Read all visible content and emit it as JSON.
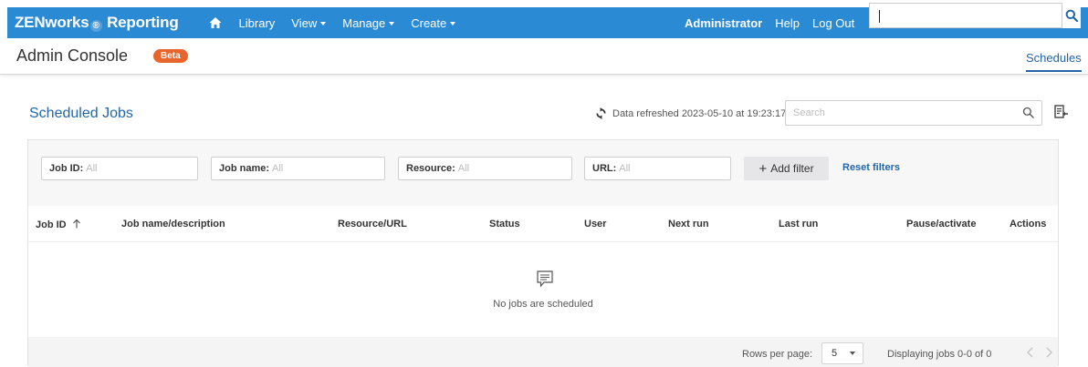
{
  "topbar": {
    "brand_prefix": "ZENworks",
    "brand_reg": "®",
    "brand_suffix": " Reporting",
    "nav": [
      {
        "label": "Library",
        "dropdown": false
      },
      {
        "label": "View",
        "dropdown": true
      },
      {
        "label": "Manage",
        "dropdown": true
      },
      {
        "label": "Create",
        "dropdown": true
      }
    ],
    "user": "Administrator",
    "help": "Help",
    "logout": "Log Out",
    "search_value": ""
  },
  "header": {
    "title": "Admin Console",
    "badge": "Beta",
    "tab": "Schedules"
  },
  "section": {
    "title": "Scheduled Jobs",
    "refresh_text": "Data refreshed 2023-05-10 at 19:23:17",
    "search_placeholder": "Search"
  },
  "filters": [
    {
      "label": "Job ID:",
      "value": "All"
    },
    {
      "label": "Job name:",
      "value": "All"
    },
    {
      "label": "Resource:",
      "value": "All"
    },
    {
      "label": "URL:",
      "value": "All"
    }
  ],
  "add_filter": "Add filter",
  "reset_filters": "Reset filters",
  "table": {
    "columns": [
      "Job ID",
      "Job name/description",
      "Resource/URL",
      "Status",
      "User",
      "Next run",
      "Last run",
      "Pause/activate",
      "Actions"
    ],
    "sort_column": "Job ID",
    "sort_direction": "ascending",
    "empty_text": "No jobs are scheduled"
  },
  "footer": {
    "rows_label": "Rows per page:",
    "rows_value": "5",
    "display_text": "Displaying jobs 0-0 of 0"
  },
  "colors": {
    "topbar": "#2a8ad4",
    "link": "#2366a8",
    "badge": "#e8652c"
  },
  "icons": [
    "home-icon",
    "search-icon",
    "refresh-icon",
    "export-icon",
    "sort-up-icon",
    "comment-icon",
    "chevron-left-icon",
    "chevron-right-icon"
  ]
}
